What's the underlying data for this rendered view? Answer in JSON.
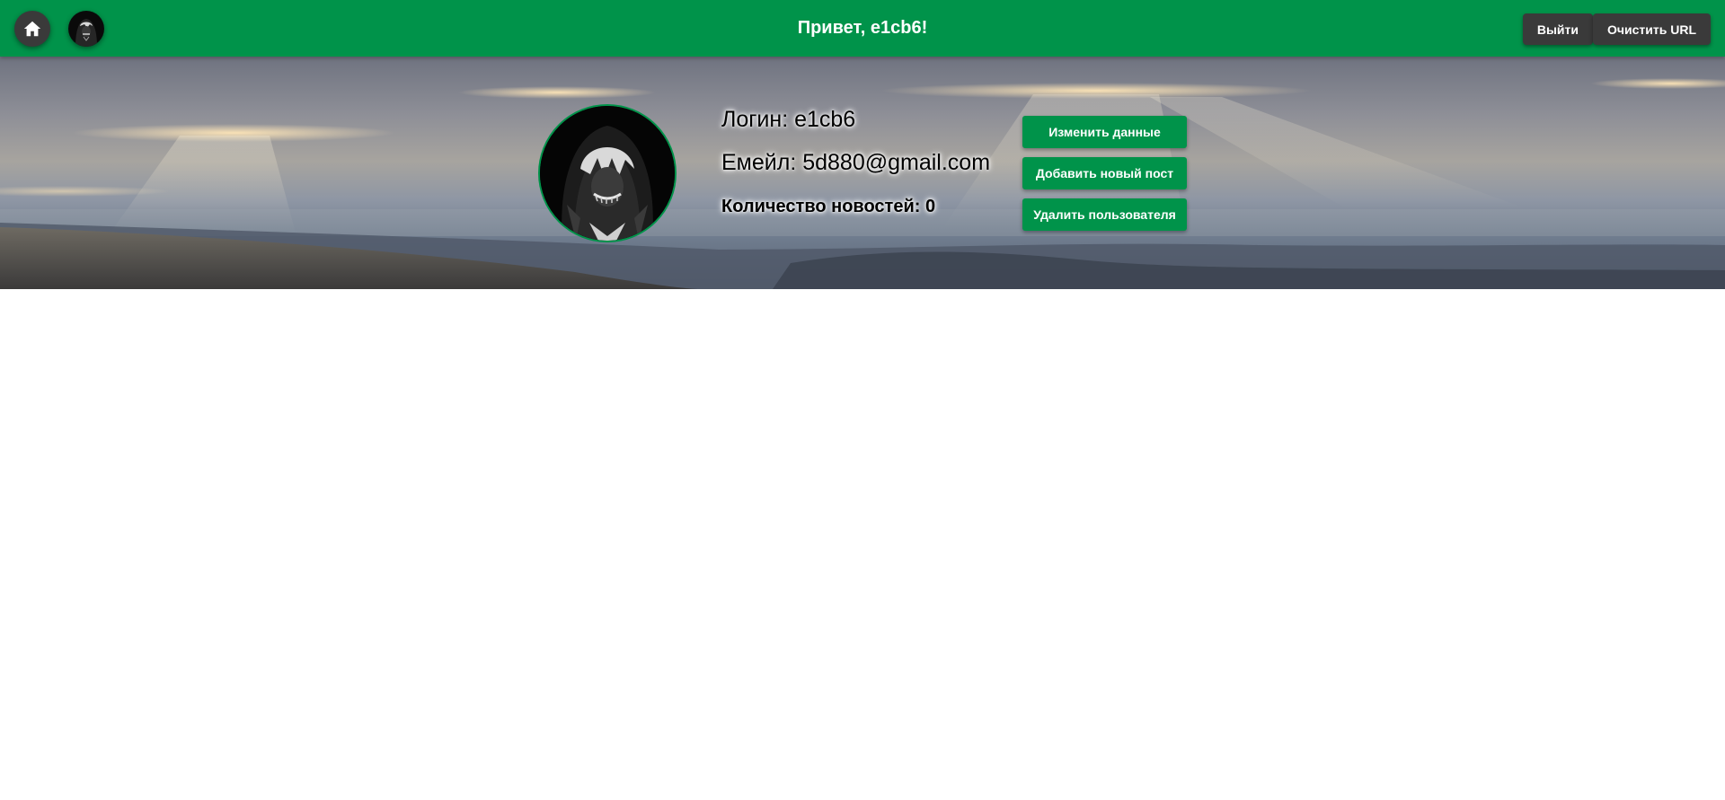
{
  "header": {
    "greeting": "Привет, e1cb6!",
    "logout_label": "Выйти",
    "clear_url_label": "Очистить URL",
    "home_icon": "home-icon",
    "avatar_icon": "user-avatar"
  },
  "profile": {
    "login_text": "Логин: e1cb6",
    "email_text": "Емейл: 5d880@gmail.com",
    "news_count_text": "Количество новостей: 0"
  },
  "actions": {
    "edit_label": "Изменить данные",
    "add_post_label": "Добавить новый пост",
    "delete_user_label": "Удалить пользователя"
  },
  "colors": {
    "brand_green": "#00934a",
    "dark_button": "#3a3a3a"
  }
}
